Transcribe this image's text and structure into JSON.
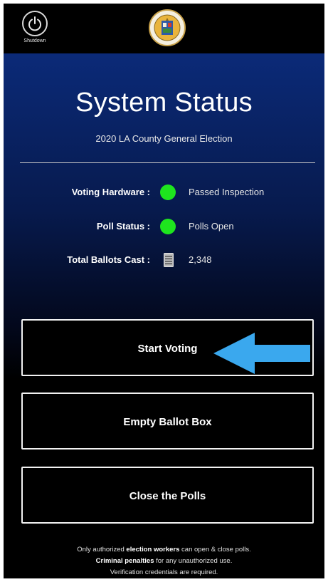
{
  "topbar": {
    "shutdown_label": "Shutdown",
    "shutdown_icon": "power-icon",
    "seal_icon": "county-seal-logo"
  },
  "header": {
    "title": "System Status",
    "subtitle": "2020 LA County General Election"
  },
  "status": [
    {
      "label": "Voting Hardware :",
      "indicator": "green-dot",
      "value": "Passed Inspection"
    },
    {
      "label": "Poll Status :",
      "indicator": "green-dot",
      "value": "Polls Open"
    },
    {
      "label": "Total Ballots Cast :",
      "indicator": "ballot-icon",
      "value": "2,348"
    }
  ],
  "buttons": {
    "start_voting": "Start Voting",
    "empty_ballot_box": "Empty Ballot Box",
    "close_polls": "Close the Polls"
  },
  "footer": {
    "line1_pre": "Only authorized ",
    "line1_bold": "election workers",
    "line1_post": " can open & close polls.",
    "line2_bold": "Criminal penalties",
    "line2_post": " for any unauthorized use.",
    "line3": "Verification credentials are required."
  },
  "colors": {
    "status_ok": "#1ee51e",
    "arrow": "#3aa8ee",
    "gradient_top": "#0b2a78"
  }
}
